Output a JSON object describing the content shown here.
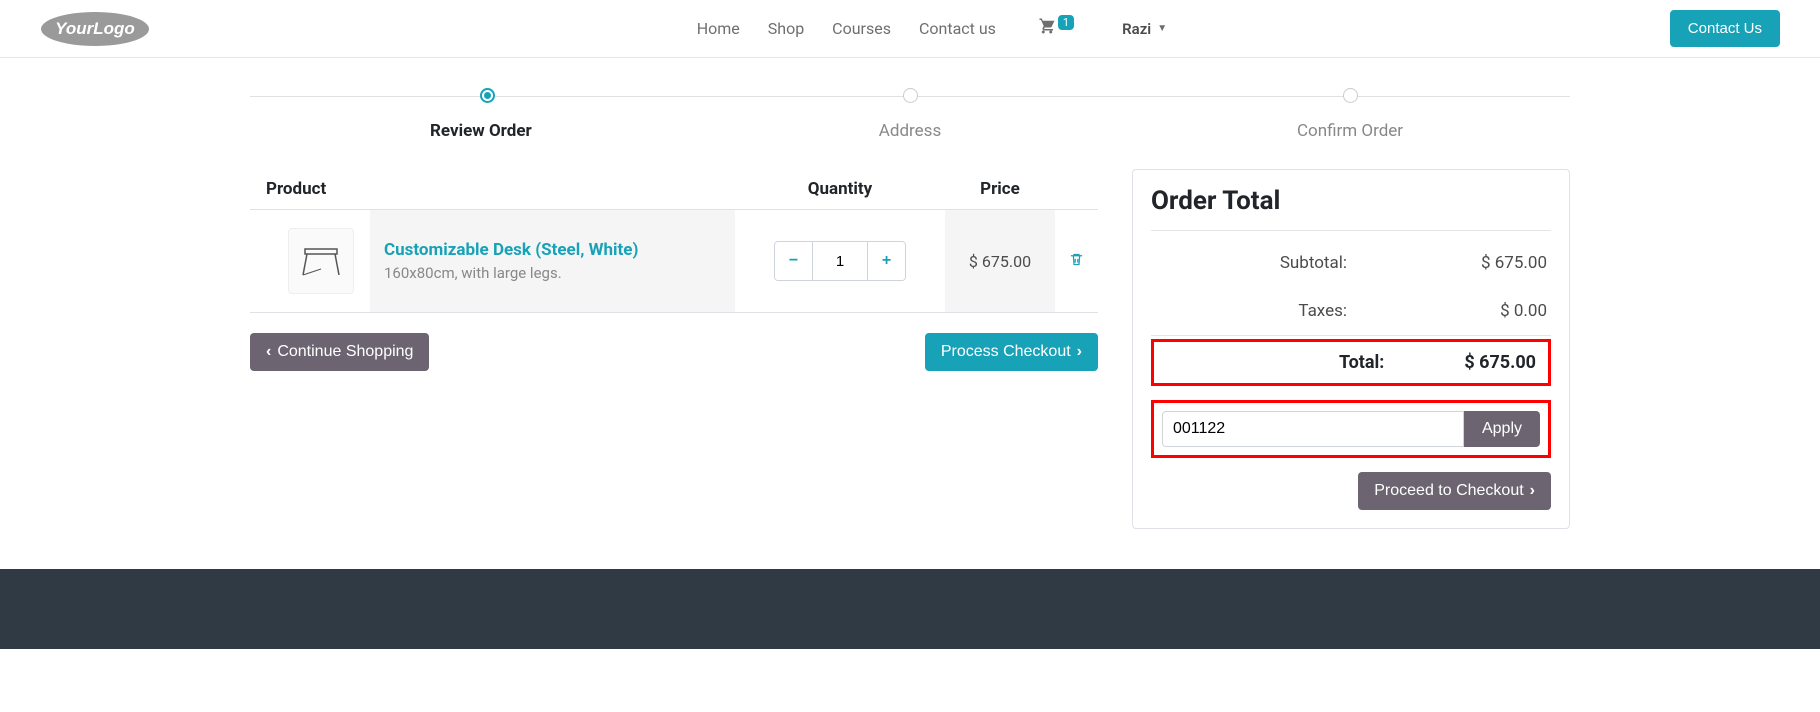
{
  "header": {
    "logo_text": "YourLogo",
    "nav": {
      "home": "Home",
      "shop": "Shop",
      "courses": "Courses",
      "contact": "Contact us"
    },
    "cart_count": "1",
    "user_name": "Razi",
    "contact_btn": "Contact Us"
  },
  "wizard": {
    "step1": "Review Order",
    "step2": "Address",
    "step3": "Confirm Order"
  },
  "table": {
    "col_product": "Product",
    "col_qty": "Quantity",
    "col_price": "Price",
    "item": {
      "name": "Customizable Desk (Steel, White)",
      "desc": "160x80cm, with large legs.",
      "qty": "1",
      "price": "$ 675.00"
    }
  },
  "buttons": {
    "continue_shopping": "Continue Shopping",
    "process_checkout": "Process Checkout"
  },
  "summary": {
    "title": "Order Total",
    "subtotal_label": "Subtotal:",
    "subtotal_value": "$ 675.00",
    "taxes_label": "Taxes:",
    "taxes_value": "$ 0.00",
    "total_label": "Total:",
    "total_value": "$ 675.00",
    "promo_value": "001122",
    "apply": "Apply",
    "proceed": "Proceed to Checkout"
  }
}
